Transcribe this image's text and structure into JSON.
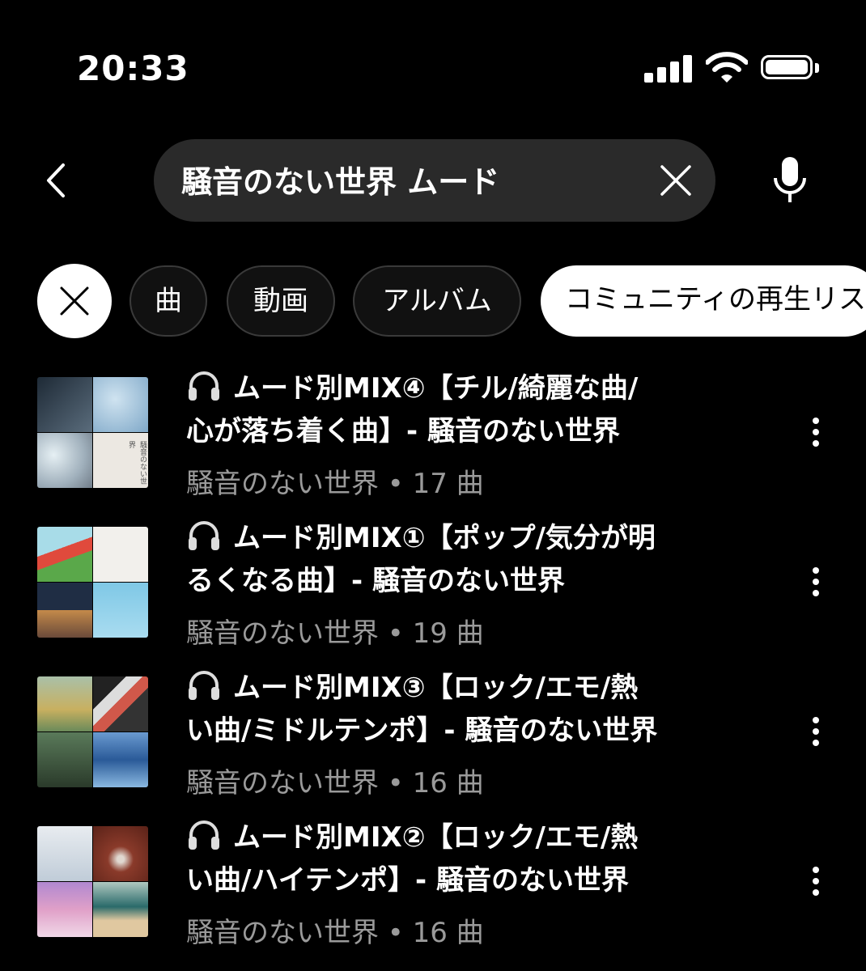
{
  "status_bar": {
    "time": "20:33",
    "signal_icon": "cellular-signal-icon",
    "wifi_icon": "wifi-icon",
    "battery_icon": "battery-icon"
  },
  "search": {
    "query": "騒音のない世界 ムード",
    "back_icon": "chevron-left-icon",
    "clear_icon": "close-icon",
    "mic_icon": "microphone-icon"
  },
  "filters": {
    "clear_icon": "close-icon",
    "chips": [
      {
        "label": "曲"
      },
      {
        "label": "動画"
      },
      {
        "label": "アルバム"
      },
      {
        "label": "コミュニティの再生リスト",
        "selected": true
      }
    ]
  },
  "results": [
    {
      "title": "🎧 ムード別MIX④【チル/綺麗な曲/心が落ち着く曲】- 騒音のない世界",
      "title_line1": "ムード別MIX④【チル/綺麗な曲/",
      "title_line2": "心が落ち着く曲】- 騒音のない世界",
      "meta": "騒音のない世界 • 17 曲",
      "thumb_colors": [
        "#3c4a58",
        "#8fb4cf",
        "#c9d4dc",
        "#e6e2dc"
      ],
      "thumb_text": "騒音のない世界"
    },
    {
      "title": "🎧 ムード別MIX①【ポップ/気分が明るくなる曲】- 騒音のない世界",
      "title_line1": "ムード別MIX①【ポップ/気分が明",
      "title_line2": "るくなる曲】- 騒音のない世界",
      "meta": "騒音のない世界 • 19 曲",
      "thumb_colors": [
        "#9fd0e0",
        "#eeeeee",
        "#2e3f57",
        "#8ecfe8"
      ]
    },
    {
      "title": "🎧 ムード別MIX③【ロック/エモ/熱い曲/ミドルテンポ】- 騒音のない世界",
      "title_line1": "ムード別MIX③【ロック/エモ/熱",
      "title_line2": "い曲/ミドルテンポ】- 騒音のない世界",
      "meta": "騒音のない世界 • 16 曲",
      "thumb_colors": [
        "#a8b898",
        "#3a3a3a",
        "#4e6a5a",
        "#3f6fa8"
      ]
    },
    {
      "title": "🎧 ムード別MIX②【ロック/エモ/熱い曲/ハイテンポ】- 騒音のない世界",
      "title_line1": "ムード別MIX②【ロック/エモ/熱",
      "title_line2": "い曲/ハイテンポ】- 騒音のない世界",
      "meta": "騒音のない世界 • 16 曲",
      "thumb_colors": [
        "#cfd6de",
        "#7a3a2e",
        "#b79ad0",
        "#c9b08a"
      ]
    }
  ],
  "more_icon": "more-vertical-icon",
  "headphone_icon": "headphones-icon"
}
